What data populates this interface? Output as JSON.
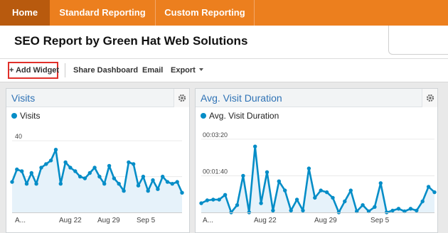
{
  "nav": {
    "tabs": [
      {
        "label": "Home",
        "active": true
      },
      {
        "label": "Standard Reporting",
        "active": false
      },
      {
        "label": "Custom Reporting",
        "active": false
      }
    ]
  },
  "page": {
    "title": "SEO Report by Green Hat Web Solutions"
  },
  "toolbar": {
    "add_widget": "+ Add Widget",
    "share_dashboard": "Share Dashboard",
    "email": "Email",
    "export": "Export"
  },
  "colors": {
    "accent": "#ec7f1e",
    "active_tab": "#b85a0e",
    "series": "#058dc7",
    "widget_title": "#2e72b5"
  },
  "widgets": [
    {
      "title": "Visits",
      "legend": "Visits",
      "chart_data": {
        "type": "area",
        "series": [
          {
            "name": "Visits",
            "values": [
              17,
              24,
              23,
              16,
              22,
              16,
              25,
              27,
              29,
              35,
              16,
              28,
              25,
              23,
              20,
              19,
              22,
              25,
              20,
              16,
              26,
              19,
              16,
              12,
              28,
              27,
              15,
              20,
              12,
              18,
              13,
              20,
              17,
              16,
              17,
              11
            ]
          }
        ],
        "x_tick_labels": [
          "A...",
          "Aug 22",
          "Aug 29",
          "Sep 5"
        ],
        "y_tick_labels": [
          "40",
          "20"
        ],
        "ylim": [
          0,
          46
        ]
      }
    },
    {
      "title": "Avg. Visit Duration",
      "legend": "Avg. Visit Duration",
      "chart_data": {
        "type": "area",
        "series": [
          {
            "name": "Avg. Visit Duration",
            "values": [
              25,
              33,
              35,
              35,
              48,
              0,
              20,
              100,
              0,
              180,
              25,
              110,
              5,
              85,
              60,
              5,
              35,
              5,
              120,
              40,
              60,
              55,
              40,
              0,
              30,
              60,
              3,
              20,
              3,
              15,
              80,
              0,
              5,
              10,
              3,
              10,
              5,
              30,
              70,
              55
            ]
          }
        ],
        "x_tick_labels": [
          "A...",
          "Aug 22",
          "Aug 29",
          "Sep 5"
        ],
        "y_tick_labels": [
          "00:03:20",
          "00:01:40"
        ],
        "ylim": [
          0,
          225
        ]
      }
    }
  ]
}
